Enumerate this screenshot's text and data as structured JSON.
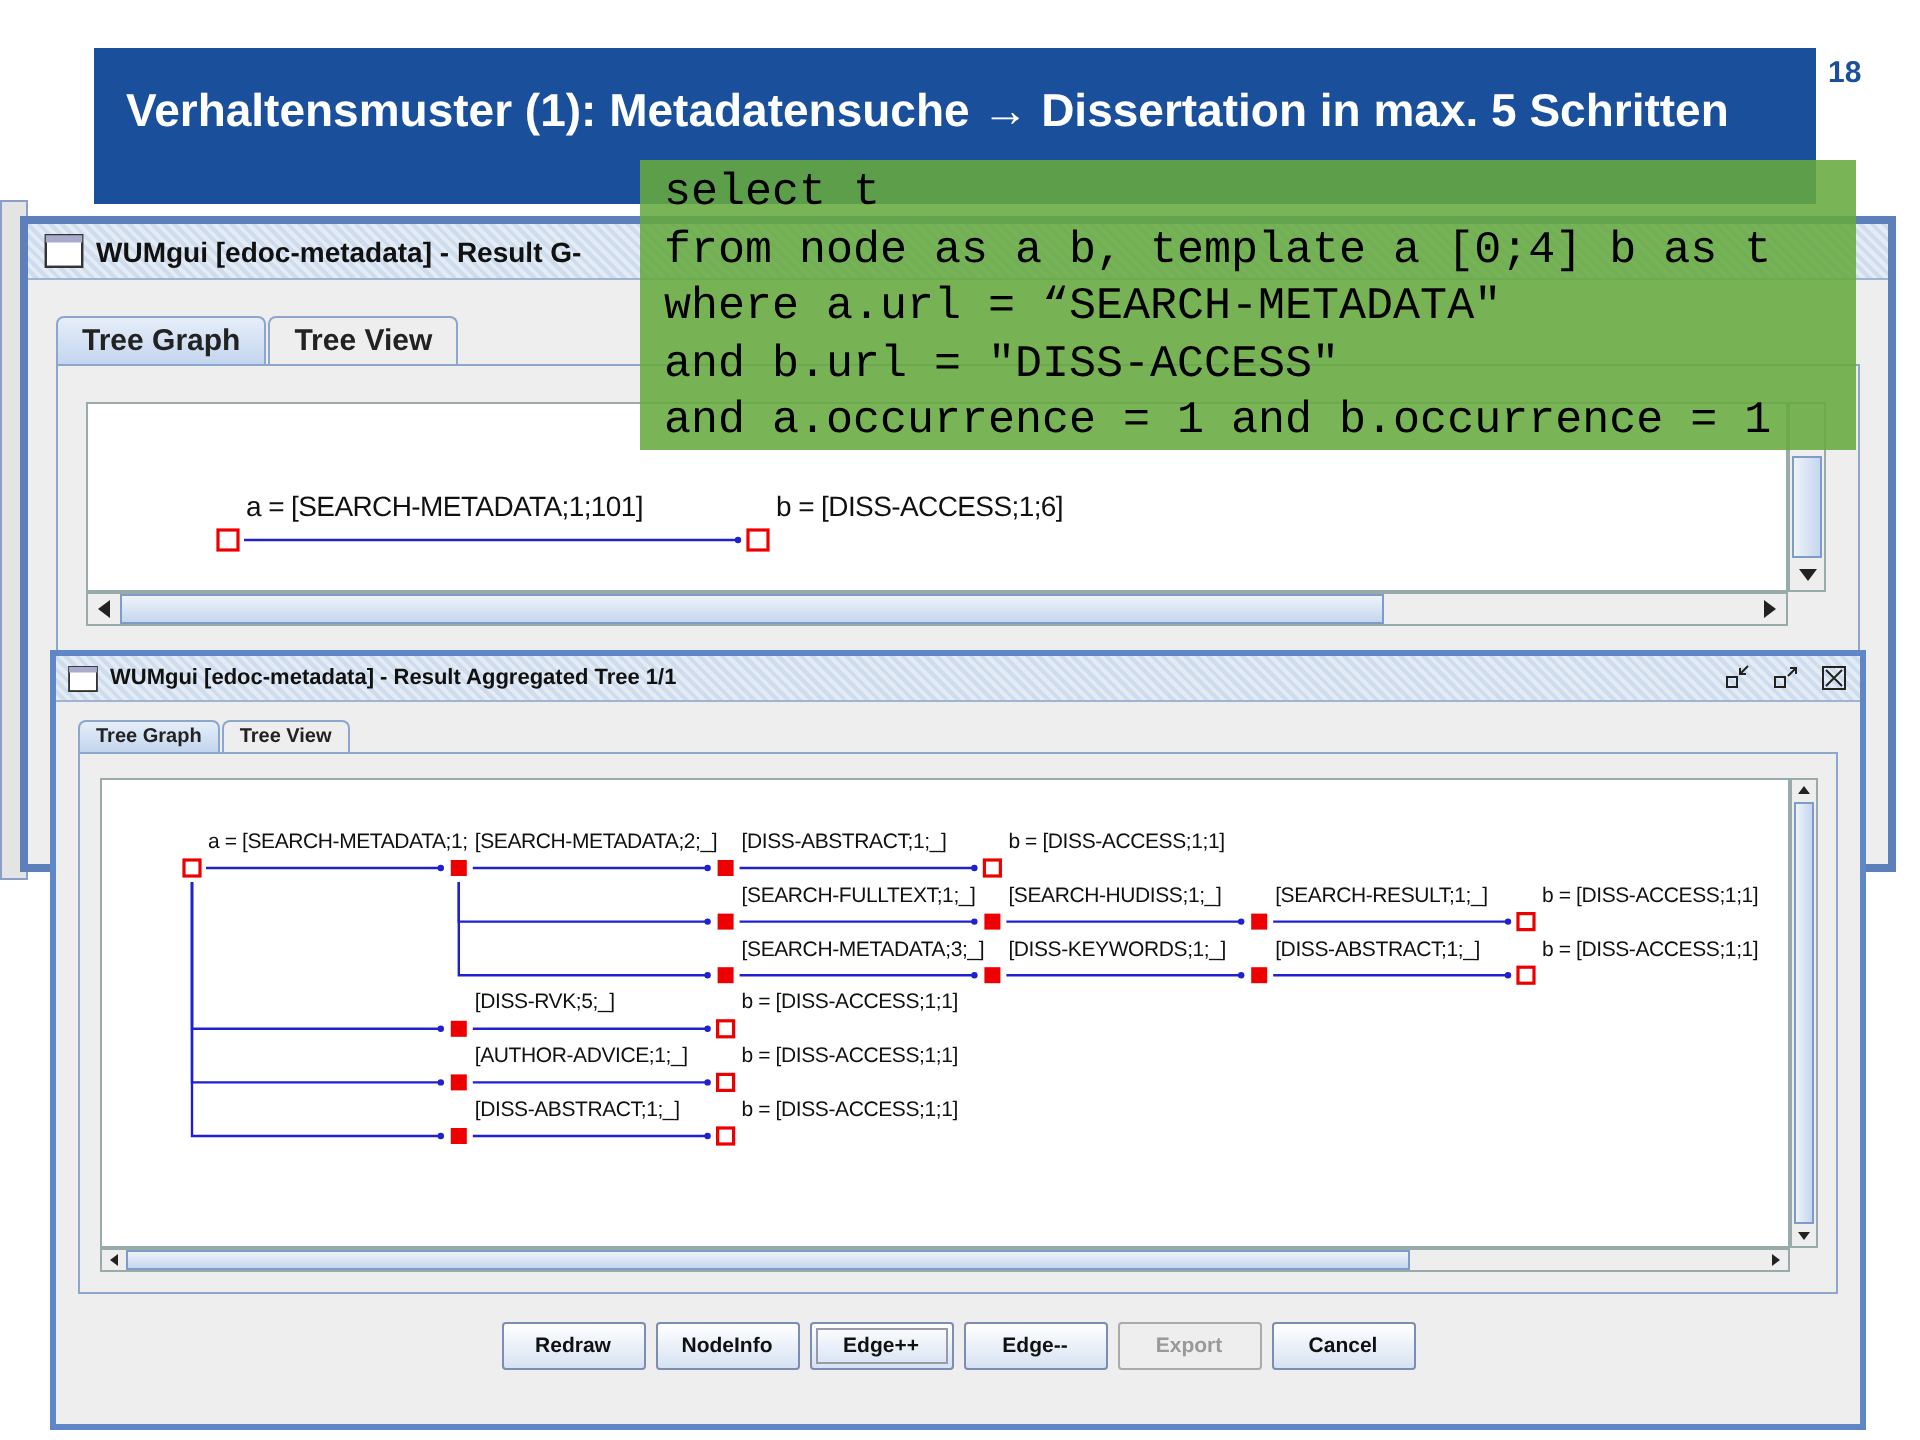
{
  "slide": {
    "title": "Verhaltensmuster (1): Metadatensuche → Dissertation in max. 5 Schritten",
    "page_number": "18"
  },
  "sequence_window": {
    "title": "WUMgui [edoc-metadata] - Result G-",
    "tabs": [
      {
        "label": "Tree Graph",
        "selected": true
      },
      {
        "label": "Tree View",
        "selected": false
      }
    ],
    "graph": {
      "label": "a = [SEARCH-METADATA;1;101]",
      "kind": "endpoint",
      "children": [
        {
          "label": "b = [DISS-ACCESS;1;6]",
          "kind": "endpoint"
        }
      ]
    }
  },
  "query_overlay": {
    "lines": [
      "select t",
      "from node as a b, template a [0;4] b as t",
      "where a.url = “SEARCH-METADATA\"",
      "and b.url = \"DISS-ACCESS\"",
      "and a.occurrence = 1 and b.occurrence = 1"
    ]
  },
  "tree_window": {
    "title": "WUMgui [edoc-metadata] - Result Aggregated Tree 1/1",
    "tabs": [
      {
        "label": "Tree Graph",
        "selected": true
      },
      {
        "label": "Tree View",
        "selected": false
      }
    ],
    "tree": {
      "label": "a = [SEARCH-METADATA;1;",
      "kind": "endpoint",
      "children": [
        {
          "label": "[SEARCH-METADATA;2;_]",
          "kind": "step",
          "children": [
            {
              "label": "[DISS-ABSTRACT;1;_]",
              "kind": "step",
              "children": [
                {
                  "label": "b = [DISS-ACCESS;1;1]",
                  "kind": "endpoint"
                }
              ]
            },
            {
              "label": "[SEARCH-FULLTEXT;1;_]",
              "kind": "step",
              "children": [
                {
                  "label": "[SEARCH-HUDISS;1;_]",
                  "kind": "step",
                  "children": [
                    {
                      "label": "[SEARCH-RESULT;1;_]",
                      "kind": "step",
                      "children": [
                        {
                          "label": "b = [DISS-ACCESS;1;1]",
                          "kind": "endpoint"
                        }
                      ]
                    }
                  ]
                }
              ]
            },
            {
              "label": "[SEARCH-METADATA;3;_]",
              "kind": "step",
              "children": [
                {
                  "label": "[DISS-KEYWORDS;1;_]",
                  "kind": "step",
                  "children": [
                    {
                      "label": "[DISS-ABSTRACT;1;_]",
                      "kind": "step",
                      "children": [
                        {
                          "label": "b = [DISS-ACCESS;1;1]",
                          "kind": "endpoint"
                        }
                      ]
                    }
                  ]
                }
              ]
            }
          ]
        },
        {
          "label": "[DISS-RVK;5;_]",
          "kind": "step",
          "children": [
            {
              "label": "b = [DISS-ACCESS;1;1]",
              "kind": "endpoint"
            }
          ]
        },
        {
          "label": "[AUTHOR-ADVICE;1;_]",
          "kind": "step",
          "children": [
            {
              "label": "b = [DISS-ACCESS;1;1]",
              "kind": "endpoint"
            }
          ]
        },
        {
          "label": "[DISS-ABSTRACT;1;_]",
          "kind": "step",
          "children": [
            {
              "label": "b = [DISS-ACCESS;1;1]",
              "kind": "endpoint"
            }
          ]
        }
      ]
    },
    "buttons": [
      {
        "label": "Redraw",
        "disabled": false,
        "focused": false
      },
      {
        "label": "NodeInfo",
        "disabled": false,
        "focused": false
      },
      {
        "label": "Edge++",
        "disabled": false,
        "focused": true
      },
      {
        "label": "Edge--",
        "disabled": false,
        "focused": false
      },
      {
        "label": "Export",
        "disabled": true,
        "focused": false
      },
      {
        "label": "Cancel",
        "disabled": false,
        "focused": false
      }
    ]
  }
}
